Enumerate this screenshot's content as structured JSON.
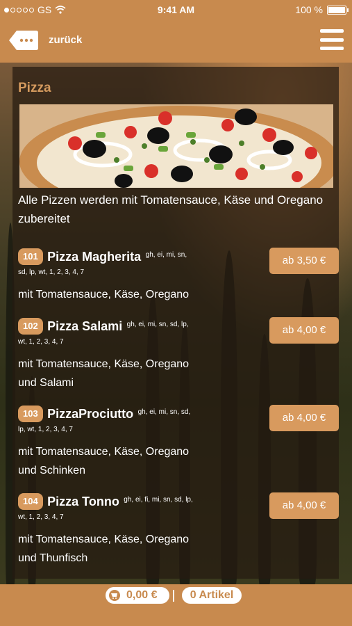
{
  "status": {
    "carrier": "GS",
    "time": "9:41 AM",
    "battery": "100 %"
  },
  "header": {
    "back_label": "zurück"
  },
  "section": {
    "title": "Pizza",
    "intro": "Alle Pizzen werden mit Tomatensauce, Käse und Oregano zubereitet"
  },
  "items": [
    {
      "number": "101",
      "name": "Pizza Magherita",
      "allergens_1": "gh, ei, mi, sn,",
      "allergens_2": "sd, lp, wt, 1, 2, 3, 4, 7",
      "desc_1": "mit Tomatensauce, Käse, Oregano",
      "desc_2": "",
      "price": "ab 3,50 €"
    },
    {
      "number": "102",
      "name": "Pizza Salami",
      "allergens_1": "gh, ei, mi, sn, sd, lp,",
      "allergens_2": "wt, 1, 2, 3, 4, 7",
      "desc_1": "mit Tomatensauce, Käse, Oregano",
      "desc_2": "und Salami",
      "price": "ab 4,00 €"
    },
    {
      "number": "103",
      "name": "PizzaProciutto",
      "allergens_1": "gh, ei, mi, sn, sd,",
      "allergens_2": "lp, wt, 1, 2, 3, 4, 7",
      "desc_1": "mit Tomatensauce, Käse, Oregano",
      "desc_2": "und Schinken",
      "price": "ab 4,00 €"
    },
    {
      "number": "104",
      "name": "Pizza Tonno",
      "allergens_1": "gh, ei, fi, mi, sn, sd, lp,",
      "allergens_2": "wt, 1, 2, 3, 4, 7",
      "desc_1": "mit Tomatensauce, Käse, Oregano",
      "desc_2": "und Thunfisch",
      "price": "ab 4,00 €"
    }
  ],
  "footer": {
    "cart_total": "0,00 €",
    "item_count": "0 Artikel"
  },
  "colors": {
    "brand": "#c88a4e",
    "accent": "#d89a5e",
    "title": "#d49a5e"
  },
  "icons": [
    "back-icon",
    "menu-icon",
    "cart-icon",
    "wifi-icon",
    "battery-icon"
  ]
}
